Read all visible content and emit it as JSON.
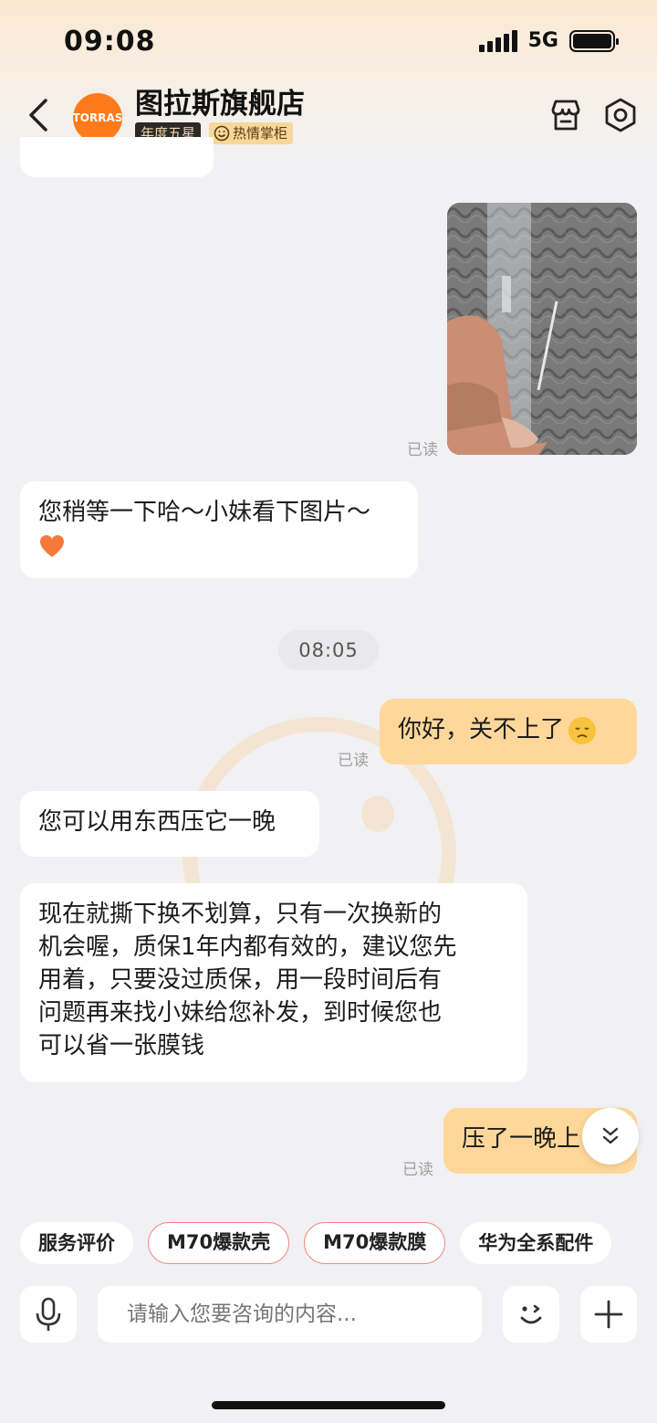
{
  "status_bar": {
    "time": "09:08",
    "network": "5G"
  },
  "header": {
    "shop_name": "图拉斯旗舰店",
    "avatar_text": "TORRAS",
    "badges": [
      "年度五星",
      "热情掌柜"
    ]
  },
  "messages": [
    {
      "from": "me",
      "type": "image",
      "read_label": "已读"
    },
    {
      "from": "shop",
      "text": "您稍等一下哈～小妹看下图片～",
      "emoji": "orange-heart"
    },
    {
      "type": "timestamp",
      "text": "08:05"
    },
    {
      "from": "me",
      "text": "你好，关不上了",
      "emoji": "sad-face",
      "read_label": "已读"
    },
    {
      "from": "shop",
      "text": "您可以用东西压它一晚"
    },
    {
      "from": "shop",
      "lines": [
        "现在就撕下换不划算，只有一次换新的",
        "机会喔，质保1年内都有效的，建议您先",
        "用着，只要没过质保，用一段时间后有",
        "问题再来找小妹给您补发，到时候您也",
        "可以省一张膜钱"
      ]
    },
    {
      "from": "me",
      "text": "压了一晚上",
      "read_label": "已读"
    }
  ],
  "quick_chips": [
    "服务评价",
    "M70爆款壳",
    "M70爆款膜",
    "华为全系配件"
  ],
  "input": {
    "placeholder": "请输入您要咨询的内容..."
  },
  "colors": {
    "accent_orange": "#ff7a1a",
    "my_bubble": "#ffd79a",
    "chip_border": "#f28b82"
  }
}
